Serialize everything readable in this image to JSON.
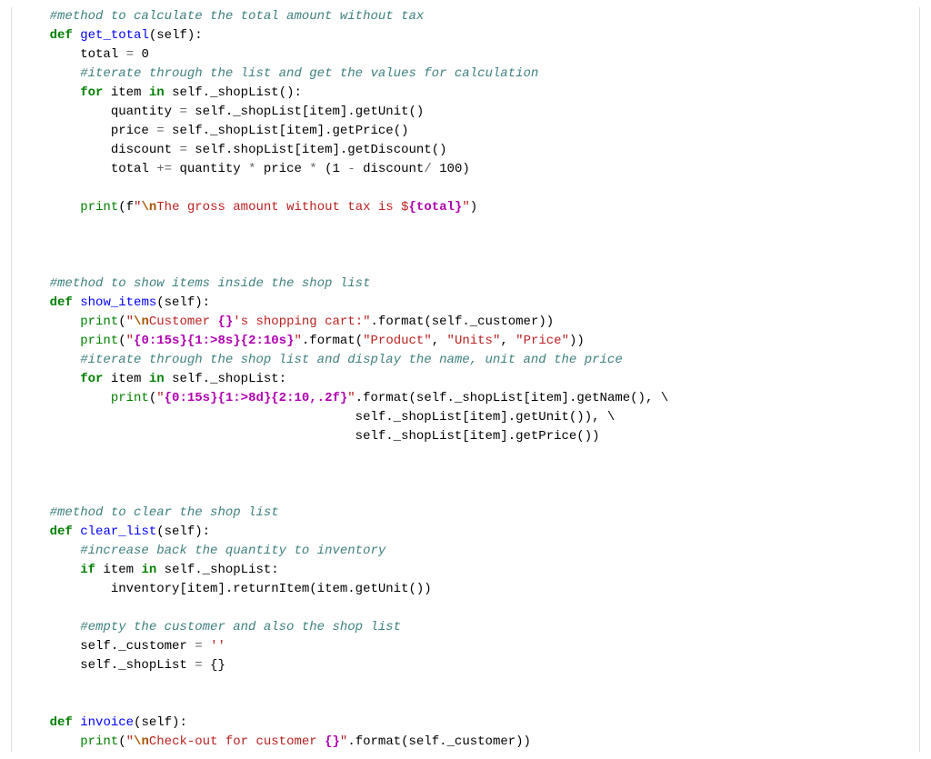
{
  "c1": "#method to calculate the total amount without tax",
  "kw_def1": "def",
  "fn1": "get_total",
  "p1": "(self):",
  "l3a": "total ",
  "l3op": "=",
  "l3b": " 0",
  "c2": "#iterate through the list and get the values for calculation",
  "kw_for1": "for",
  "l5a": " item ",
  "kw_in1": "in",
  "l5b": " self._shopList():",
  "l6a": "quantity ",
  "l6op": "=",
  "l6b": " self._shopList[item].getUnit()",
  "l7a": "price ",
  "l7op": "=",
  "l7b": " self._shopList[item].getPrice()",
  "l8a": "discount ",
  "l8op": "=",
  "l8b": " self.shopList[item].getDiscount()",
  "l9a": "total ",
  "l9op": "+=",
  "l9b": " quantity ",
  "l9op2": "*",
  "l9c": " price ",
  "l9op3": "*",
  "l9d": " (1 ",
  "l9op4": "-",
  "l9e": " discount",
  "l9op5": "/",
  "l9f": " 100)",
  "print1": "print",
  "l11a": "(f",
  "l11s1": "\"",
  "l11esc": "\\n",
  "l11s2": "The gross amount without tax is $",
  "l11int": "{total}",
  "l11s3": "\"",
  "l11b": ")",
  "c3": "#method to show items inside the shop list",
  "kw_def2": "def",
  "fn2": "show_items",
  "p2": "(self):",
  "print2": "print",
  "l15a": "(",
  "l15s1": "\"",
  "l15esc": "\\n",
  "l15s2": "Customer ",
  "l15br": "{}",
  "l15s3": "'s shopping cart:\"",
  "l15b": ".format(self._customer))",
  "print3": "print",
  "l16a": "(",
  "l16s1": "\"",
  "l16fmt1": "{0:15s}{1:>8s}{2:10s}",
  "l16s2": "\"",
  "l16b": ".format(",
  "l16s3": "\"Product\"",
  "l16c": ", ",
  "l16s4": "\"Units\"",
  "l16d": ", ",
  "l16s5": "\"Price\"",
  "l16e": "))",
  "c4": "#iterate through the shop list and display the name, unit and the price",
  "kw_for2": "for",
  "l18a": " item ",
  "kw_in2": "in",
  "l18b": " self._shopList:",
  "print4": "print",
  "l19a": "(",
  "l19s1": "\"",
  "l19fmt": "{0:15s}{1:>8d}{2:10,.2f}",
  "l19s2": "\"",
  "l19b": ".format(self._shopList[item].getName(), \\",
  "l20": "self._shopList[item].getUnit()), \\",
  "l21": "self._shopList[item].getPrice())",
  "c5": "#method to clear the shop list",
  "kw_def3": "def",
  "fn3": "clear_list",
  "p3": "(self):",
  "c6": "#increase back the quantity to inventory",
  "kw_if1": "if",
  "l26a": " item ",
  "kw_in3": "in",
  "l26b": " self._shopList:",
  "l27": "inventory[item].returnItem(item.getUnit())",
  "c7": "#empty the customer and also the shop list",
  "l29a": "self._customer ",
  "l29op": "=",
  "l29b": " ",
  "l29s": "''",
  "l30a": "self._shopList ",
  "l30op": "=",
  "l30b": " {}",
  "kw_def4": "def",
  "fn4": "invoice",
  "p4": "(self):",
  "print5": "print",
  "l33a": "(",
  "l33s1": "\"",
  "l33esc": "\\n",
  "l33s2": "Check-out for customer ",
  "l33br": "{}",
  "l33s3": "\"",
  "l33b": ".format(self._customer))"
}
